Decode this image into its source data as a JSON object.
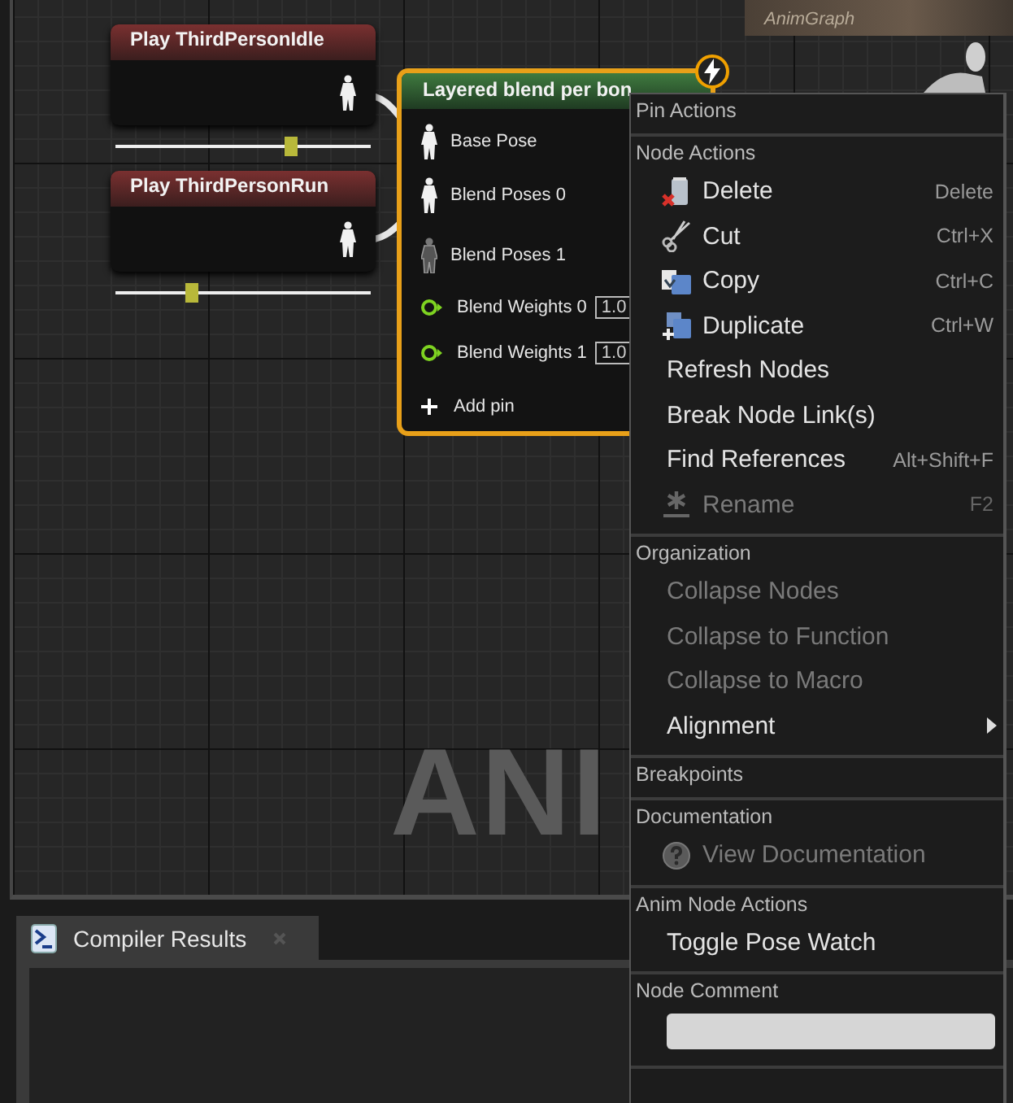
{
  "graph": {
    "watermark": "ANI",
    "header": {
      "subtitle": "AnimGraph"
    },
    "players": [
      {
        "title": "Play ThirdPersonIdle",
        "level": 0.69
      },
      {
        "title": "Play ThirdPersonRun",
        "level": 0.3
      }
    ],
    "blend_node": {
      "title": "Layered blend per bon",
      "selected": true,
      "pins": [
        {
          "label": "Base Pose",
          "kind": "pose",
          "connected": true
        },
        {
          "label": "Blend Poses 0",
          "kind": "pose",
          "connected": true
        },
        {
          "label": "Blend Poses 1",
          "kind": "pose",
          "connected": false
        },
        {
          "label": "Blend Weights 0",
          "kind": "float",
          "value": "1.0"
        },
        {
          "label": "Blend Weights 1",
          "kind": "float",
          "value": "1.0"
        }
      ],
      "add_pin": "Add pin"
    }
  },
  "context_menu": {
    "sections": [
      {
        "heading": "Pin Actions"
      },
      {
        "heading": "Node Actions",
        "items": [
          {
            "label": "Delete",
            "shortcut": "Delete",
            "kind": "delete",
            "disabled": false
          },
          {
            "label": "Cut",
            "shortcut": "Ctrl+X",
            "kind": "cut",
            "disabled": false
          },
          {
            "label": "Copy",
            "shortcut": "Ctrl+C",
            "kind": "copy",
            "disabled": false
          },
          {
            "label": "Duplicate",
            "shortcut": "Ctrl+W",
            "kind": "duplicate",
            "disabled": false
          },
          {
            "label": "Refresh Nodes",
            "disabled": false
          },
          {
            "label": "Break Node Link(s)",
            "disabled": false
          },
          {
            "label": "Find References",
            "shortcut": "Alt+Shift+F",
            "disabled": false
          },
          {
            "label": "Rename",
            "shortcut": "F2",
            "kind": "rename",
            "disabled": true
          }
        ]
      },
      {
        "heading": "Organization",
        "items": [
          {
            "label": "Collapse Nodes",
            "disabled": true
          },
          {
            "label": "Collapse to Function",
            "disabled": true
          },
          {
            "label": "Collapse to Macro",
            "disabled": true
          },
          {
            "label": "Alignment",
            "disabled": false,
            "submenu": true
          }
        ]
      },
      {
        "heading": "Breakpoints"
      },
      {
        "heading": "Documentation",
        "items": [
          {
            "label": "View Documentation",
            "kind": "help",
            "disabled": true
          }
        ]
      },
      {
        "heading": "Anim Node Actions",
        "items": [
          {
            "label": "Toggle Pose Watch",
            "disabled": false
          }
        ]
      },
      {
        "heading": "Node Comment",
        "has_field": true
      }
    ]
  },
  "bottom_panel": {
    "tabs": [
      {
        "label": "Compiler Results",
        "selected": true
      }
    ]
  }
}
